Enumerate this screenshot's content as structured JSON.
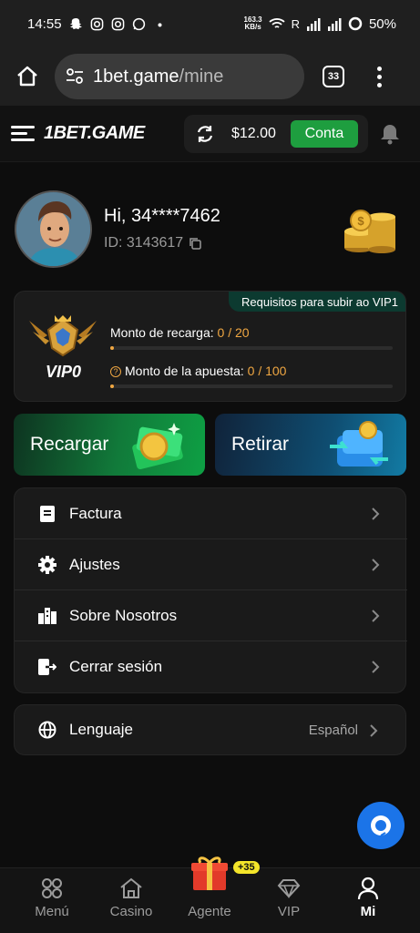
{
  "status_bar": {
    "time": "14:55",
    "net_speed_top": "163.3",
    "net_speed_unit": "KB/s",
    "carrier_flag": "R",
    "battery": "50%"
  },
  "browser": {
    "url_domain": "1bet.game",
    "url_path": "/mine",
    "tab_count": "33"
  },
  "header": {
    "brand": "1BET.GAME",
    "balance": "$12.00",
    "account_label": "Conta"
  },
  "profile": {
    "greeting": "Hi, 34****7462",
    "id_label": "ID: 3143617"
  },
  "vip": {
    "badge_label": "VIP0",
    "requirement_title": "Requisitos para subir ao VIP1",
    "recharge_label": "Monto de recarga: ",
    "recharge_value": "0 / 20",
    "recharge_progress": 0,
    "bet_label": "Monto de la apuesta: ",
    "bet_value": "0 / 100",
    "bet_progress": 0
  },
  "actions": {
    "recharge": "Recargar",
    "withdraw": "Retirar"
  },
  "menu": {
    "items": [
      {
        "label": "Factura",
        "icon": "invoice-icon"
      },
      {
        "label": "Ajustes",
        "icon": "gear-icon"
      },
      {
        "label": "Sobre Nosotros",
        "icon": "building-icon"
      },
      {
        "label": "Cerrar sesión",
        "icon": "logout-icon"
      }
    ]
  },
  "language": {
    "label": "Lenguaje",
    "value": "Español",
    "icon": "globe-icon"
  },
  "bottom_nav": {
    "items": [
      {
        "label": "Menú",
        "icon": "grid-icon"
      },
      {
        "label": "Casino",
        "icon": "house-icon"
      },
      {
        "label": "Agente",
        "icon": "gift-icon"
      },
      {
        "label": "VIP",
        "icon": "diamond-icon"
      },
      {
        "label": "Mi",
        "icon": "user-icon"
      }
    ],
    "agent_badge": "+35"
  },
  "colors": {
    "accent_green": "#1e9e3f",
    "vip_orange": "#f0a742",
    "support_blue": "#1b74e8"
  }
}
